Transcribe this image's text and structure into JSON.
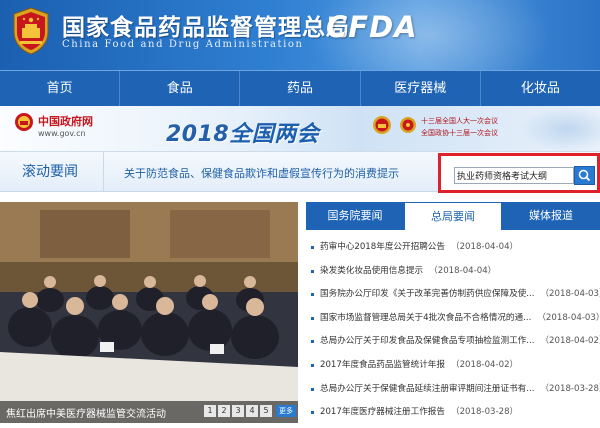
{
  "header": {
    "title": "国家食品药品监督管理总局",
    "subtitle": "China Food and Drug Administration",
    "logo_text": "CFDA"
  },
  "nav": {
    "items": [
      {
        "label": "首页"
      },
      {
        "label": "食品"
      },
      {
        "label": "药品"
      },
      {
        "label": "医疗器械"
      },
      {
        "label": "化妆品"
      }
    ]
  },
  "banner": {
    "gov_site_name": "中国政府网",
    "gov_site_url": "www.gov.cn",
    "meeting_year": "2018",
    "meeting_title": "全国两会",
    "session_line1": "十三届全国人大一次会议",
    "session_line2": "全国政协十三届一次会议"
  },
  "scroll_news": {
    "label": "滚动要闻",
    "text": "关于防范食品、保健食品欺诈和虚假宣传行为的消费提示"
  },
  "search": {
    "value": "执业药师资格考试大纲"
  },
  "photo": {
    "caption": "焦红出席中美医疗器械监管交流活动",
    "pages": [
      "1",
      "2",
      "3",
      "4",
      "5"
    ],
    "more_label": "更多"
  },
  "tabs": [
    {
      "label": "国务院要闻",
      "active": false
    },
    {
      "label": "总局要闻",
      "active": true
    },
    {
      "label": "媒体报道",
      "active": false
    }
  ],
  "news": [
    {
      "title": "药审中心2018年度公开招聘公告",
      "date": "（2018-04-04）"
    },
    {
      "title": "染发类化妆品使用信息提示",
      "date": "（2018-04-04）"
    },
    {
      "title": "国务院办公厅印发《关于改革完善仿制药供应保障及使...",
      "date": "（2018-04-03）"
    },
    {
      "title": "国家市场监督管理总局关于4批次食品不合格情况的通...",
      "date": "（2018-04-03）"
    },
    {
      "title": "总局办公厅关于印发食品及保健食品专项抽检监测工作...",
      "date": "（2018-04-02）"
    },
    {
      "title": "2017年度食品药品监管统计年报",
      "date": "（2018-04-02）"
    },
    {
      "title": "总局办公厅关于保健食品延续注册审评期间注册证书有...",
      "date": "（2018-03-28）"
    },
    {
      "title": "2017年度医疗器械注册工作报告",
      "date": "（2018-03-28）"
    }
  ],
  "colors": {
    "brand_blue": "#1e63b4",
    "highlight_red": "#e0202a",
    "gov_red": "#c8161d"
  },
  "icons": [
    "national-emblem-icon",
    "gov-emblem-icon",
    "npc-emblem-icon",
    "cppcc-emblem-icon",
    "search-icon"
  ]
}
